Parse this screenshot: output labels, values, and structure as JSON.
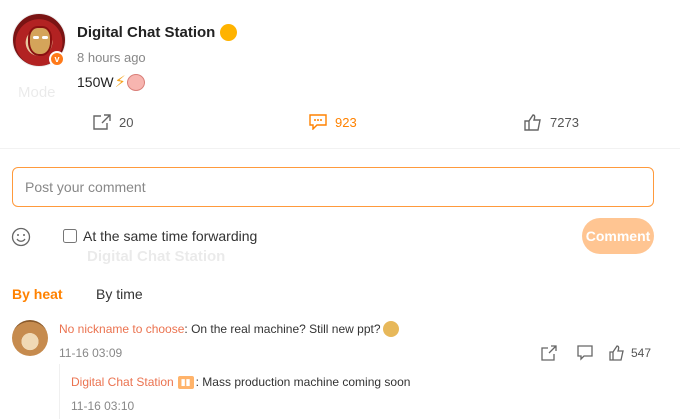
{
  "post": {
    "author": "Digital Chat Station",
    "time": "8 hours ago",
    "content": "150W",
    "actions": {
      "forward_count": "20",
      "comment_count": "923",
      "like_count": "7273"
    }
  },
  "compose": {
    "placeholder": "Post your comment",
    "forward_label": "At the same time forwarding",
    "submit_label": "Comment"
  },
  "tabs": {
    "by_heat": "By heat",
    "by_time": "By time"
  },
  "comment": {
    "user": "No nickname to choose",
    "text": " : On the real machine? Still new ppt?",
    "time": "11-16 03:09",
    "like_count": "547",
    "reply": {
      "user": "Digital Chat Station",
      "text": ": Mass production machine coming soon",
      "time": "11-16 03:10"
    }
  },
  "colors": {
    "accent": "#ff8200",
    "username": "#eb7350",
    "button": "#ffc592",
    "input_border": "#ff9a3c"
  }
}
